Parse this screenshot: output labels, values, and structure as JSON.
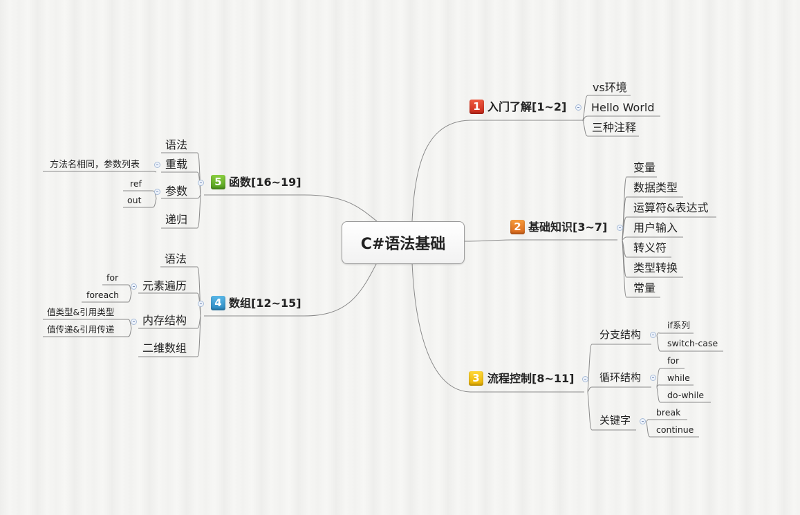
{
  "root": "C#语法基础",
  "branches": {
    "b1": {
      "badge": "1",
      "label": "入门了解[1~2]",
      "children": [
        "vs环境",
        "Hello World",
        "三种注释"
      ]
    },
    "b2": {
      "badge": "2",
      "label": "基础知识[3~7]",
      "children": [
        "变量",
        "数据类型",
        "运算符&表达式",
        "用户输入",
        "转义符",
        "类型转换",
        "常量"
      ]
    },
    "b3": {
      "badge": "3",
      "label": "流程控制[8~11]",
      "children": [
        {
          "label": "分支结构",
          "children": [
            "if系列",
            "switch-case"
          ]
        },
        {
          "label": "循环结构",
          "children": [
            "for",
            "while",
            "do-while"
          ]
        },
        {
          "label": "关键字",
          "children": [
            "break",
            "continue"
          ]
        }
      ]
    },
    "b4": {
      "badge": "4",
      "label": "数组[12~15]",
      "children": [
        {
          "label": "语法"
        },
        {
          "label": "元素遍历",
          "children": [
            "for",
            "foreach"
          ]
        },
        {
          "label": "内存结构",
          "children": [
            "值类型&引用类型",
            "值传递&引用传递"
          ]
        },
        {
          "label": "二维数组"
        }
      ]
    },
    "b5": {
      "badge": "5",
      "label": "函数[16~19]",
      "children": [
        {
          "label": "语法"
        },
        {
          "label": "重载",
          "children": [
            "方法名相同，参数列表"
          ]
        },
        {
          "label": "参数",
          "children": [
            "ref",
            "out"
          ]
        },
        {
          "label": "递归"
        }
      ]
    }
  },
  "colors": {
    "line": "#8a8a8a",
    "b1": "#d83a28",
    "b2": "#e97b28",
    "b3": "#f4c414",
    "b4": "#3aa0d8",
    "b5": "#6cbc2c"
  }
}
